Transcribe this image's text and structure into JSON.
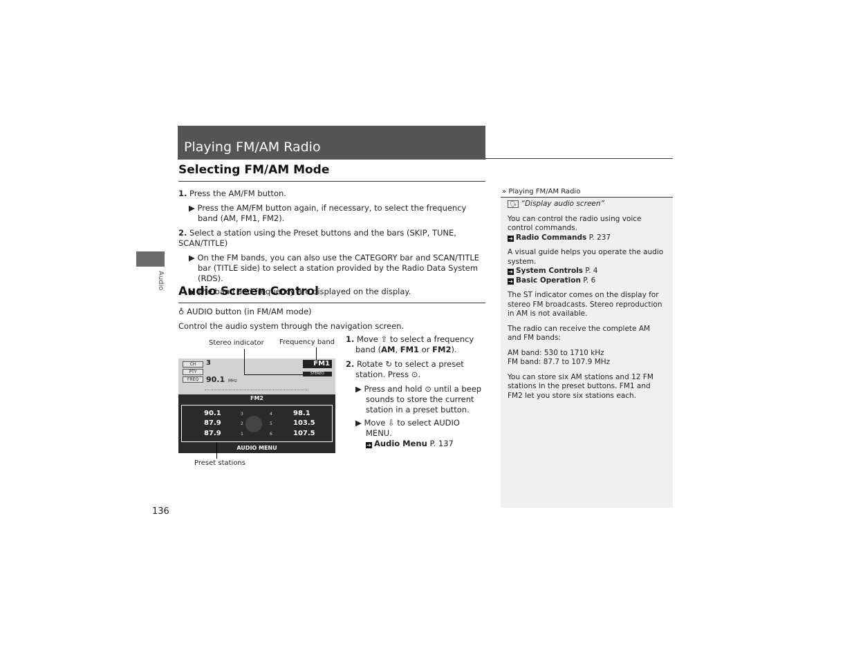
{
  "title": "Playing FM/AM Radio",
  "side_tab": "Audio",
  "section1": {
    "heading": "Selecting FM/AM Mode",
    "step1": "1.",
    "step1_text": "Press the AM/FM button.",
    "step1_sub": "Press the AM/FM button again, if necessary, to select the frequency band (AM, FM1, FM2).",
    "step2": "2.",
    "step2_text": "Select a station using the Preset buttons and the bars (SKIP, TUNE, SCAN/TITLE)",
    "step2_sub1": "On the FM bands, you can also use the CATEGORY bar and SCAN/TITLE bar (TITLE side) to select a station provided by the Radio Data System (RDS).",
    "step2_sub2": "The band and frequency are displayed on the display."
  },
  "section2": {
    "heading": "Audio Screen Control",
    "button_line": "AUDIO button (in FM/AM mode)",
    "intro": "Control the audio system through the navigation screen.",
    "callouts": {
      "stereo": "Stereo indicator",
      "band": "Frequency band",
      "presets": "Preset stations"
    },
    "screen": {
      "ch_label": "CH",
      "ch": "3",
      "pty_label": "PTY",
      "freq_label": "FREQ",
      "freq": "90.1",
      "unit": "MHz",
      "band": "FM1",
      "stereo": "STEREO",
      "list_band": "FM2",
      "menu": "AUDIO MENU",
      "presets": [
        {
          "n": "3",
          "f": "90.1"
        },
        {
          "n": "2",
          "f": "87.9"
        },
        {
          "n": "1",
          "f": "87.9"
        },
        {
          "n": "4",
          "f": "98.1"
        },
        {
          "n": "5",
          "f": "103.5"
        },
        {
          "n": "6",
          "f": "107.5"
        }
      ]
    },
    "s1": "1.",
    "s1_a": "Move",
    "s1_b": "to select a frequency band (",
    "am": "AM",
    "fm1": "FM1",
    "fm2": "FM2",
    "s1_c": "), ",
    "s1_or": " or ",
    "s1_end": ").",
    "s2": "2.",
    "s2_a": "Rotate",
    "s2_b": "to select a preset station. Press",
    "s2_sub1": "Press and hold",
    "s2_sub1b": "until a beep sounds to store the current station in a preset button.",
    "s2_sub2": "Move",
    "s2_sub2b": "to select",
    "audio_menu": "AUDIO MENU",
    "ref_label": "Audio Menu",
    "ref_page": "P. 137"
  },
  "sidebar": {
    "header": "Playing FM/AM Radio",
    "voice": "“Display audio screen”",
    "p1": "You can control the radio using voice control commands.",
    "r1": "Radio Commands",
    "r1p": "P. 237",
    "p2": "A visual guide helps you operate the audio system.",
    "r2": "System Controls",
    "r2p": "P. 4",
    "r3": "Basic Operation",
    "r3p": "P. 6",
    "p3": "The ST indicator comes on the display for stereo FM broadcasts. Stereo reproduction in AM is not available.",
    "p4": "The radio can receive the complete AM and FM bands:",
    "p5a": "AM band: 530 to 1710 kHz",
    "p5b": "FM band: 87.7 to 107.9 MHz",
    "p6": "You can store six AM stations and 12 FM stations in the preset buttons. FM1 and FM2 let you store six stations each."
  },
  "page_number": "136"
}
